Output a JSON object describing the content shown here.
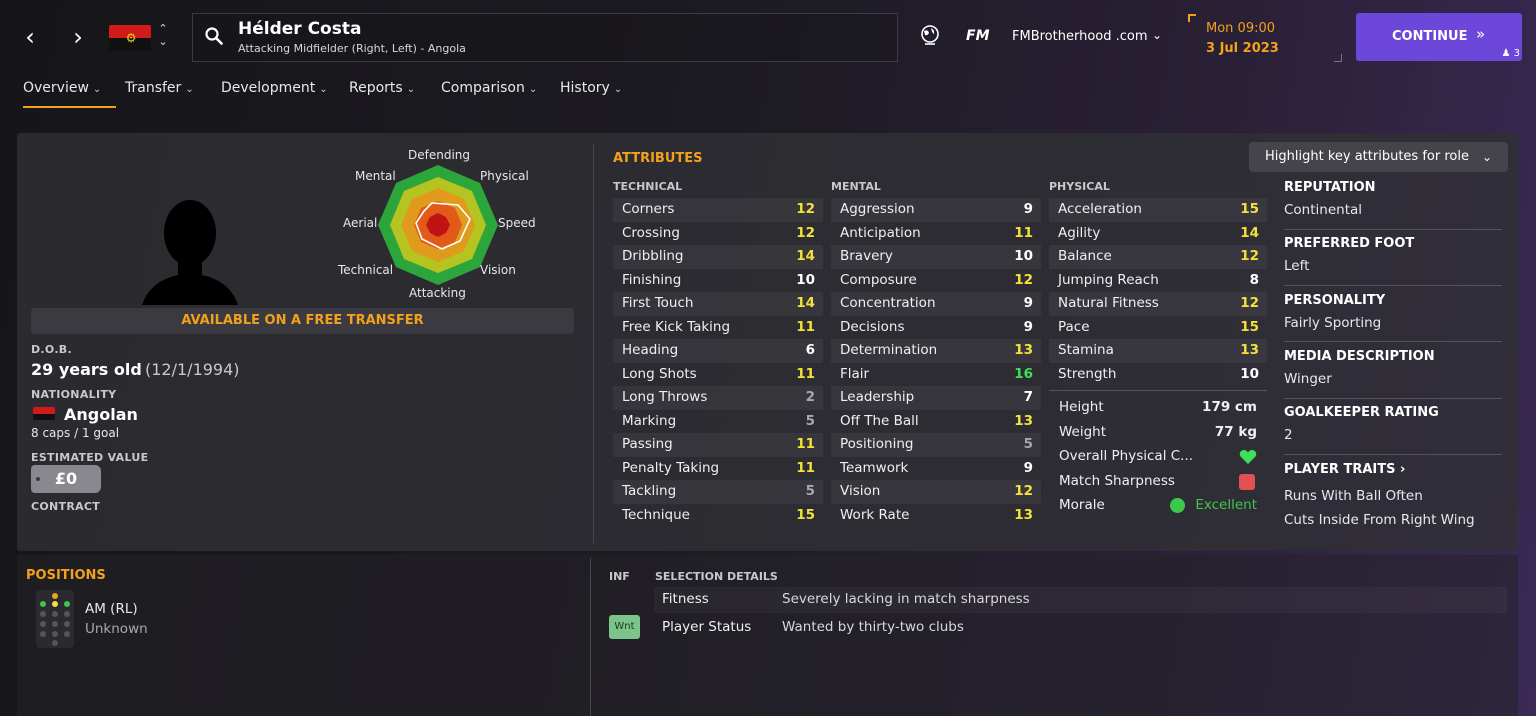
{
  "header": {
    "player_name": "Hélder Costa",
    "player_subtitle": "Attacking Midfielder (Right, Left) - Angola",
    "fm_logo": "FM",
    "skin_name": "FMBrotherhood .com",
    "date_line1": "Mon 09:00",
    "date_line2": "3 Jul 2023",
    "continue_label": "CONTINUE",
    "continue_badge": "3",
    "icons": [
      "back-arrow-icon",
      "forward-arrow-icon",
      "search-icon",
      "globe-icon",
      "chevron-down-icon",
      "double-chevron-right-icon"
    ]
  },
  "tabs": [
    {
      "label": "Overview"
    },
    {
      "label": "Transfer"
    },
    {
      "label": "Development"
    },
    {
      "label": "Reports"
    },
    {
      "label": "Comparison"
    },
    {
      "label": "History"
    }
  ],
  "profile": {
    "radar_labels": {
      "defending": "Defending",
      "physical": "Physical",
      "speed": "Speed",
      "vision": "Vision",
      "attacking": "Attacking",
      "technical": "Technical",
      "aerial": "Aerial",
      "mental": "Mental"
    },
    "banner": "AVAILABLE ON A FREE TRANSFER",
    "dob_label": "D.O.B.",
    "dob_age": "29 years old",
    "dob_date": "(12/1/1994)",
    "nationality_label": "NATIONALITY",
    "nationality": "Angolan",
    "caps": "8 caps / 1 goal",
    "value_label": "ESTIMATED VALUE",
    "value": "£0",
    "contract_label": "CONTRACT"
  },
  "attributes": {
    "heading": "ATTRIBUTES",
    "highlight_button": "Highlight key attributes for role",
    "technical_header": "TECHNICAL",
    "mental_header": "MENTAL",
    "physical_header": "PHYSICAL",
    "technical": [
      {
        "name": "Corners",
        "value": "12"
      },
      {
        "name": "Crossing",
        "value": "12"
      },
      {
        "name": "Dribbling",
        "value": "14"
      },
      {
        "name": "Finishing",
        "value": "10"
      },
      {
        "name": "First Touch",
        "value": "14"
      },
      {
        "name": "Free Kick Taking",
        "value": "11"
      },
      {
        "name": "Heading",
        "value": "6"
      },
      {
        "name": "Long Shots",
        "value": "11"
      },
      {
        "name": "Long Throws",
        "value": "2"
      },
      {
        "name": "Marking",
        "value": "5"
      },
      {
        "name": "Passing",
        "value": "11"
      },
      {
        "name": "Penalty Taking",
        "value": "11"
      },
      {
        "name": "Tackling",
        "value": "5"
      },
      {
        "name": "Technique",
        "value": "15"
      }
    ],
    "mental": [
      {
        "name": "Aggression",
        "value": "9"
      },
      {
        "name": "Anticipation",
        "value": "11"
      },
      {
        "name": "Bravery",
        "value": "10"
      },
      {
        "name": "Composure",
        "value": "12"
      },
      {
        "name": "Concentration",
        "value": "9"
      },
      {
        "name": "Decisions",
        "value": "9"
      },
      {
        "name": "Determination",
        "value": "13"
      },
      {
        "name": "Flair",
        "value": "16"
      },
      {
        "name": "Leadership",
        "value": "7"
      },
      {
        "name": "Off The Ball",
        "value": "13"
      },
      {
        "name": "Positioning",
        "value": "5"
      },
      {
        "name": "Teamwork",
        "value": "9"
      },
      {
        "name": "Vision",
        "value": "12"
      },
      {
        "name": "Work Rate",
        "value": "13"
      }
    ],
    "physical": [
      {
        "name": "Acceleration",
        "value": "15"
      },
      {
        "name": "Agility",
        "value": "14"
      },
      {
        "name": "Balance",
        "value": "12"
      },
      {
        "name": "Jumping Reach",
        "value": "8"
      },
      {
        "name": "Natural Fitness",
        "value": "12"
      },
      {
        "name": "Pace",
        "value": "15"
      },
      {
        "name": "Stamina",
        "value": "13"
      },
      {
        "name": "Strength",
        "value": "10"
      }
    ],
    "height_label": "Height",
    "height": "179 cm",
    "weight_label": "Weight",
    "weight": "77 kg",
    "condition_label": "Overall Physical C...",
    "sharpness_label": "Match Sharpness",
    "morale_label": "Morale",
    "morale": "Excellent",
    "colors": {
      "high": "#f2e23a",
      "very_high": "#3ce05a",
      "mid": "#ffffff",
      "low": "#a8a8ae"
    }
  },
  "info": {
    "reputation_label": "REPUTATION",
    "reputation": "Continental",
    "foot_label": "PREFERRED FOOT",
    "foot": "Left",
    "personality_label": "PERSONALITY",
    "personality": "Fairly Sporting",
    "media_label": "MEDIA DESCRIPTION",
    "media": "Winger",
    "gk_label": "GOALKEEPER RATING",
    "gk": "2",
    "traits_label": "PLAYER TRAITS",
    "traits": [
      "Runs With Ball Often",
      "Cuts Inside From Right Wing"
    ]
  },
  "positions": {
    "heading": "POSITIONS",
    "position": "AM (RL)",
    "familiarity": "Unknown"
  },
  "selection": {
    "inf_header": "INF",
    "details_header": "SELECTION DETAILS",
    "rows": [
      {
        "label": "Fitness",
        "value": "Severely lacking in match sharpness"
      },
      {
        "label": "Player Status",
        "value": "Wanted by thirty-two clubs"
      }
    ],
    "badge": "Wnt"
  }
}
